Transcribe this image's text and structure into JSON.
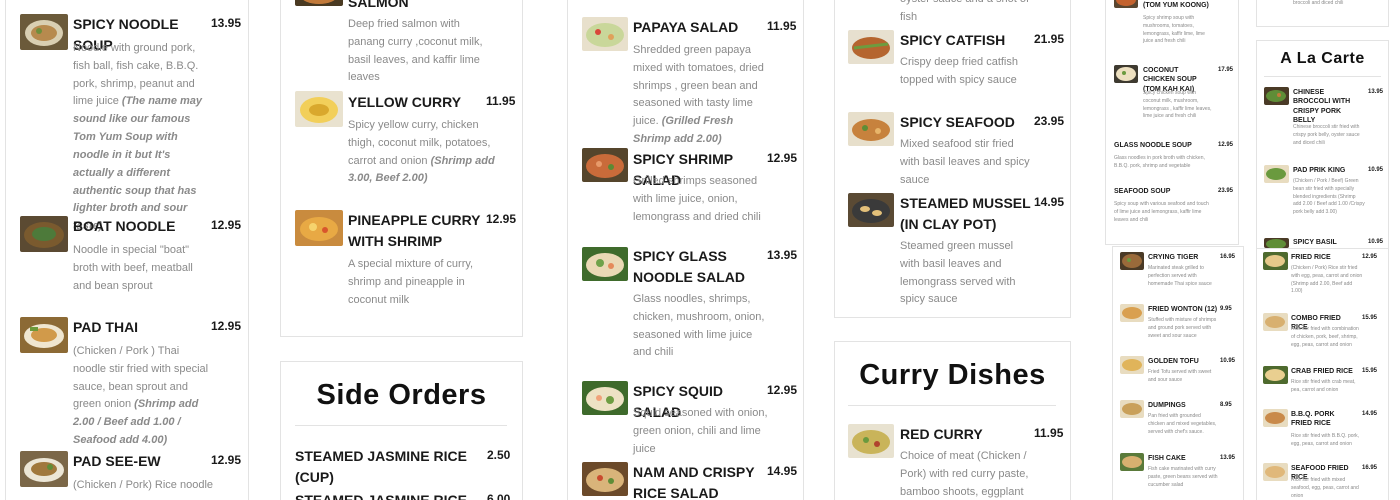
{
  "col1": [
    {
      "name": "SPICY NOODLE SOUP",
      "price": "13.95",
      "desc": "Noodle with ground pork, fish ball, fish cake, B.B.Q. pork, shrimp, peanut and lime juice",
      "note": "(The name may sound like our famous Tom Yum Soup with noodle in it but It's actually a different authentic soup that  has lighter broth and sour taste)"
    },
    {
      "name": "BOAT NOODLE",
      "price": "12.95",
      "desc": "Noodle in special \"boat\" broth with beef, meatball and bean sprout",
      "note": ""
    },
    {
      "name": "PAD THAI",
      "price": "12.95",
      "desc": "(Chicken / Pork ) Thai noodle stir fried with special sauce, bean sprout and green onion",
      "note": "(Shrimp add 2.00 / Beef add 1.00 / Seafood add 4.00)"
    },
    {
      "name": "PAD SEE-EW",
      "price": "12.95",
      "desc": "(Chicken / Pork) Rice noodle",
      "note": ""
    }
  ],
  "col2": [
    {
      "name": "SALMON",
      "price": "",
      "desc": "Deep fried salmon with panang curry ,coconut milk, basil leaves, and kaffir lime leaves",
      "note": ""
    },
    {
      "name": "YELLOW CURRY",
      "price": "11.95",
      "desc": "Spicy yellow curry, chicken thigh, coconut milk, potatoes, carrot and onion",
      "note": "(Shrimp add 3.00, Beef 2.00)"
    },
    {
      "name": "PINEAPPLE CURRY WITH SHRIMP",
      "price": "12.95",
      "desc": "A special mixture of curry, shrimp and pineapple in coconut milk",
      "note": ""
    }
  ],
  "side_orders": {
    "title": "Side Orders",
    "items": [
      {
        "name": "STEAMED JASMINE RICE (CUP)",
        "price": "2.50"
      },
      {
        "name": "STEAMED JASMINE RICE",
        "price": "6.00"
      }
    ]
  },
  "col3": [
    {
      "name": "PAPAYA SALAD",
      "price": "11.95",
      "desc": "Shredded green papaya mixed with tomatoes, dried shrimps , green bean and seasoned with tasty lime juice.",
      "note": "(Grilled Fresh Shrimp add 2.00)"
    },
    {
      "name": "SPICY SHRIMP SALAD",
      "price": "12.95",
      "desc": "Grilled shrimps seasoned with lime juice, onion, lemongrass and dried chili",
      "note": ""
    },
    {
      "name": "SPICY GLASS NOODLE SALAD",
      "price": "13.95",
      "desc": "Glass noodles, shrimps, chicken, mushroom, onion, seasoned with lime juice and chili",
      "note": ""
    },
    {
      "name": "SPICY SQUID SALAD",
      "price": "12.95",
      "desc": "Squid seasoned with onion, green onion, chili and lime juice",
      "note": ""
    },
    {
      "name": "NAM AND CRISPY RICE SALAD",
      "price": "14.95",
      "desc": "",
      "note": ""
    }
  ],
  "col4_top": {
    "fragment": "oyster sauce and a shot of fish"
  },
  "col4": [
    {
      "name": "SPICY CATFISH",
      "price": "21.95",
      "desc": "Crispy deep fried catfish topped with spicy sauce",
      "note": ""
    },
    {
      "name": "SPICY SEAFOOD",
      "price": "23.95",
      "desc": "Mixed seafood stir fried with basil leaves and spicy sauce",
      "note": ""
    },
    {
      "name": "STEAMED MUSSEL (IN CLAY POT)",
      "price": "14.95",
      "desc": "Steamed green mussel with basil leaves and lemongrass served with spicy sauce",
      "note": ""
    }
  ],
  "curry_dishes": {
    "title": "Curry Dishes",
    "items": [
      {
        "name": "RED CURRY",
        "price": "11.95",
        "desc": "Choice of meat (Chicken / Pork) with red curry paste, bamboo shoots, eggplant and",
        "note": ""
      }
    ]
  },
  "col5": [
    {
      "name": "(TOM YUM KOONG)",
      "price": "",
      "desc": "Spicy shrimp soup with mushrooms, tomatoes, lemongrass, kaffir lime, lime juice and fresh chili"
    },
    {
      "name": "COCONUT CHICKEN SOUP (TOM KAH KAI)",
      "price": "17.95",
      "desc": "Spicy chicken soup with coconut milk, mushroom, lemongrass , kaffir lime leaves, lime juice and fresh chili"
    },
    {
      "name": "GLASS NOODLE SOUP",
      "price": "12.95",
      "desc": "Glass noodles in pork broth with chicken, B.B.Q. pork, shrimp and vegetable"
    },
    {
      "name": "SEAFOOD SOUP",
      "price": "23.95",
      "desc": "Spicy soup with various seafood and touch of lime juice and lemongrass, kaffir lime leaves and chili"
    }
  ],
  "col5b": [
    {
      "name": "CRYING TIGER",
      "price": "16.95",
      "desc": "Marinated steak grilled to perfection served with homemade Thai spice sauce"
    },
    {
      "name": "FRIED WONTON (12)",
      "price": "9.95",
      "desc": "Stuffed with mixture of shrimps and ground pork served with sweet and sour sauce"
    },
    {
      "name": "GOLDEN TOFU",
      "price": "10.95",
      "desc": "Fried Tofu served with sweet and sour sauce"
    },
    {
      "name": "DUMPINGS",
      "price": "8.95",
      "desc": "Pan fried with grounded chicken and mixed vegetables, served with chef's sauce."
    },
    {
      "name": "FISH CAKE",
      "price": "13.95",
      "desc": "Fish cake marinated with curry paste, green beans served with cucumber salad"
    }
  ],
  "col6_top": {
    "fragment": "broccoli and diced chili"
  },
  "a_la_carte": {
    "title": "A La Carte",
    "items": [
      {
        "name": "CHINESE BROCCOLI WITH CRISPY PORK BELLY",
        "price": "13.95",
        "desc": "Chinese broccoli stir fried with crispy pork belly, oyster sauce and diced chili"
      },
      {
        "name": "PAD PRIK KING",
        "price": "10.95",
        "desc": "(Chicken / Pork / Beef) Green bean stir fried with specially blended ingredients (Shrimp add 2.00 / Beef add 1.00 /Crispy pork belly add 3.00)"
      },
      {
        "name": "SPICY BASIL LEAVES",
        "price": "10.95",
        "desc": ""
      }
    ]
  },
  "col6b": [
    {
      "name": "FRIED RICE",
      "price": "12.95",
      "desc": "(Chicken / Pork) Rice stir fried with egg, peas, carrot and onion (Shrimp add 2.00, Beef add 1.00)"
    },
    {
      "name": "COMBO FRIED RICE",
      "price": "15.95",
      "desc": "Rice stir fried with combination of chicken, pork, beef, shrimp, egg, peas, carrot and onion"
    },
    {
      "name": "CRAB FRIED RICE",
      "price": "15.95",
      "desc": "Rice stir fried with crab meat, pea, carrot and onion"
    },
    {
      "name": "B.B.Q. PORK FRIED RICE",
      "price": "14.95",
      "desc": "Rice stir fried with B.B.Q. pork, egg, peas, carrot and onion"
    },
    {
      "name": "SEAFOOD FRIED RICE",
      "price": "16.95",
      "desc": "Rice stir fried with mixed seafood, egg, peas, carrot and onion"
    }
  ],
  "colors": {
    "text": "#1a1a1a",
    "muted": "#8a8a8a",
    "border": "#e3e3e3",
    "background": "#ffffff"
  }
}
